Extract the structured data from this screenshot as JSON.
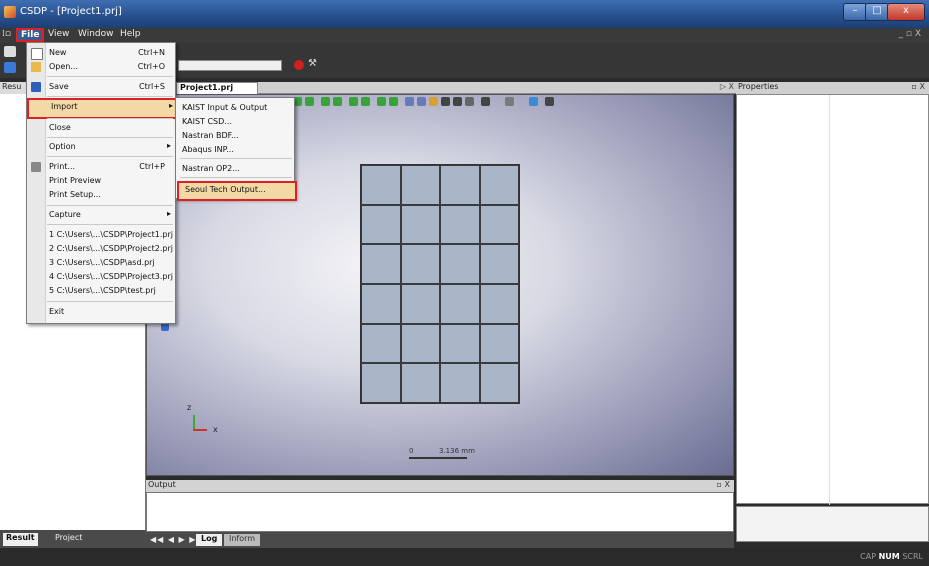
{
  "window": {
    "title": "CSDP - [Project1.prj]",
    "min_glyph": "–",
    "max_glyph": "□",
    "close_glyph": "x"
  },
  "menubar": {
    "items": [
      "File",
      "View",
      "Window",
      "Help"
    ],
    "mdi_controls": "_ ▫ X"
  },
  "left_panel": {
    "header": "Resu",
    "tabs": [
      "Result",
      "Project"
    ]
  },
  "document": {
    "tab": "Project1.prj",
    "controls": "▷ X"
  },
  "file_menu": {
    "items": [
      {
        "label": "New",
        "shortcut": "Ctrl+N",
        "icon": "new-file-icon"
      },
      {
        "label": "Open...",
        "shortcut": "Ctrl+O",
        "icon": "open-folder-icon"
      },
      {
        "label": "Save",
        "shortcut": "Ctrl+S",
        "icon": "save-disk-icon"
      },
      {
        "label": "Import",
        "arrow": "▸"
      },
      {
        "label": "Close"
      },
      {
        "label": "Option",
        "arrow": "▸"
      },
      {
        "label": "Print...",
        "shortcut": "Ctrl+P",
        "icon": "printer-icon"
      },
      {
        "label": "Print Preview"
      },
      {
        "label": "Print Setup..."
      },
      {
        "label": "Capture",
        "arrow": "▸"
      },
      {
        "label": "1 C:\\Users\\...\\CSDP\\Project1.prj"
      },
      {
        "label": "2 C:\\Users\\...\\CSDP\\Project2.prj"
      },
      {
        "label": "3 C:\\Users\\...\\CSDP\\asd.prj"
      },
      {
        "label": "4 C:\\Users\\...\\CSDP\\Project3.prj"
      },
      {
        "label": "5 C:\\Users\\...\\CSDP\\test.prj"
      },
      {
        "label": "Exit"
      }
    ]
  },
  "import_submenu": {
    "items": [
      "KAIST Input & Output",
      "KAIST CSD...",
      "Nastran BDF...",
      "Abaqus INP...",
      "Nastran OP2...",
      "Seoul Tech Output..."
    ]
  },
  "viewport": {
    "axis_z": "z",
    "axis_x": "x",
    "scale_zero": "0",
    "scale_value": "3.136 mm",
    "mesh_cols": 4,
    "mesh_rows": 6
  },
  "output": {
    "title": "Output",
    "controls": "▫ X",
    "nav": "◀◀ ◀ ▶ ▶▶",
    "tabs": [
      "Log",
      "Inform"
    ]
  },
  "properties": {
    "title": "Properties",
    "controls": "▫ X"
  },
  "statusbar": {
    "cap": "CAP",
    "num": "NUM",
    "scrl": "SCRL"
  },
  "colors": {
    "highlight_border": "#e02020",
    "menu_highlight": "#f3d9a6",
    "mesh_fill": "#a8b6c8"
  }
}
